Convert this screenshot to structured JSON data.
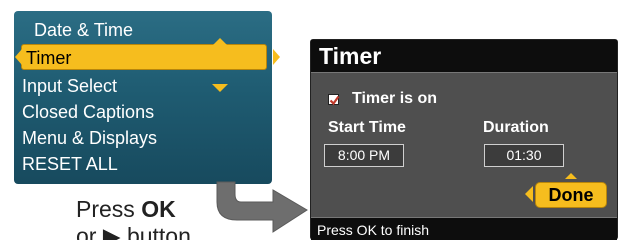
{
  "menu": {
    "items": [
      {
        "label": "Date & Time"
      },
      {
        "label": "Timer"
      },
      {
        "label": "Input Select"
      },
      {
        "label": "Closed Captions"
      },
      {
        "label": "Menu & Displays"
      },
      {
        "label": "RESET ALL"
      }
    ],
    "selected_index": 1
  },
  "instruction": {
    "press": "Press",
    "ok": "OK",
    "or": "or",
    "arrow_glyph": "▶",
    "button": "button"
  },
  "timer_dialog": {
    "title": "Timer",
    "checkbox_label": "Timer is on",
    "checkbox_checked": true,
    "start_time_label": "Start Time",
    "start_time_value": "8:00 PM",
    "duration_label": "Duration",
    "duration_value": "01:30",
    "done_label": "Done",
    "footer_text": "Press OK to finish"
  },
  "colors": {
    "menu_bg": "#1f5c72",
    "highlight": "#f6bd1e",
    "dialog_bg": "#4f4f4f",
    "title_bar": "#0d0d0d",
    "checkbox_mark": "#c0392b"
  }
}
